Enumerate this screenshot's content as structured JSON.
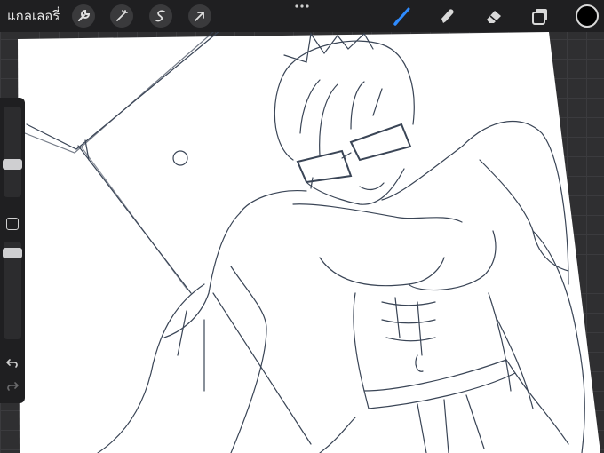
{
  "topbar": {
    "gallery_label": "แกลเลอรี่",
    "left_tools": [
      {
        "icon": "wrench-icon"
      },
      {
        "icon": "magic-wand-icon"
      },
      {
        "icon": "selection-s-icon"
      },
      {
        "icon": "transform-arrow-icon"
      }
    ],
    "right_tools": [
      {
        "icon": "brush-icon",
        "active": true
      },
      {
        "icon": "smudge-icon"
      },
      {
        "icon": "eraser-icon"
      },
      {
        "icon": "layers-icon"
      }
    ],
    "current_color": "#000000",
    "accent_color": "#2f8cff"
  },
  "sidebar": {
    "brush_size": 0.5,
    "opacity": 0.98,
    "icons": [
      "square-modify-icon",
      "undo-icon",
      "redo-icon"
    ]
  }
}
